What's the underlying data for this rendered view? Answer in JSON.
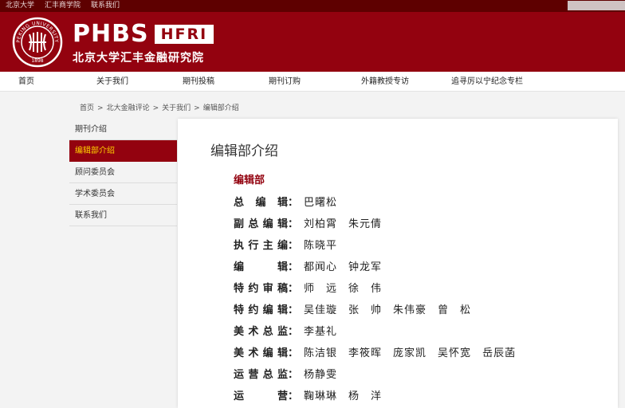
{
  "topbar": {
    "links": [
      "北京大学",
      "汇丰商学院",
      "联系我们"
    ]
  },
  "brand": {
    "seal_text": "PEKING UNIVERSITY",
    "seal_year": "1898",
    "wordmark": "PHBS",
    "badge": "HFRI",
    "name_cn": "北京大学汇丰金融研究院",
    "color": "#93020f"
  },
  "nav": {
    "items": [
      "首页",
      "关于我们",
      "期刊投稿",
      "期刊订购",
      "外籍教授专访",
      "追寻厉以宁纪念专栏"
    ]
  },
  "breadcrumb": [
    "首页",
    "北大金融评论",
    "关于我们",
    "编辑部介绍"
  ],
  "sidebar": {
    "items": [
      "期刊介绍",
      "编辑部介绍",
      "顾问委员会",
      "学术委员会",
      "联系我们"
    ],
    "active_index": 1,
    "active_color": "#ffd200"
  },
  "content": {
    "title": "编辑部介绍",
    "section": "编辑部",
    "roles": [
      {
        "role": "总编辑",
        "names": [
          "巴曙松"
        ]
      },
      {
        "role": "副总编辑",
        "names": [
          "刘柏霄",
          "朱元倩"
        ]
      },
      {
        "role": "执行主编",
        "names": [
          "陈晓平"
        ]
      },
      {
        "role": "编辑",
        "names": [
          "都闻心",
          "钟龙军"
        ]
      },
      {
        "role": "特约审稿",
        "names": [
          "师　远",
          "徐　伟"
        ]
      },
      {
        "role": "特约编辑",
        "names": [
          "吴佳璇",
          "张　帅",
          "朱伟豪",
          "曾　松"
        ]
      },
      {
        "role": "美术总监",
        "names": [
          "李基礼"
        ]
      },
      {
        "role": "美术编辑",
        "names": [
          "陈洁银",
          "李筱晖",
          "庞家凯",
          "吴怀宽",
          "岳辰菡"
        ]
      },
      {
        "role": "运营总监",
        "names": [
          "杨静雯"
        ]
      },
      {
        "role": "运营",
        "names": [
          "鞠琳琳",
          "杨　洋"
        ]
      }
    ],
    "colon": "："
  }
}
